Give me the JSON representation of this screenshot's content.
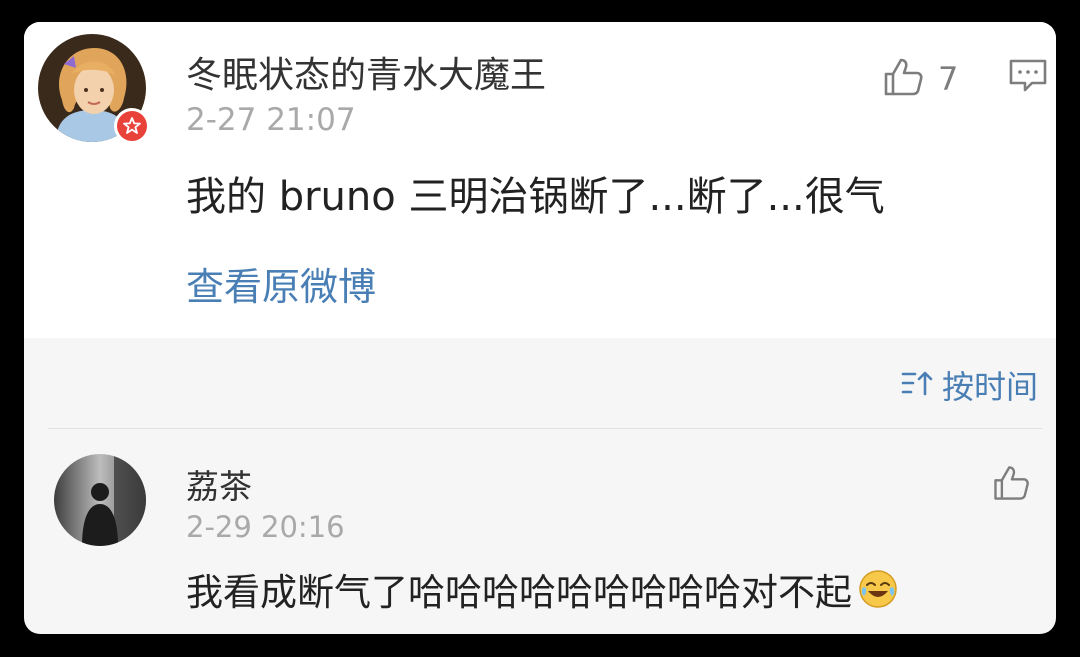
{
  "post": {
    "username": "冬眠状态的青水大魔王",
    "timestamp": "2-27 21:07",
    "text": "我的 bruno 三明治锅断了...断了...很气",
    "view_original": "查看原微博",
    "like_count": "7",
    "like_icon": "thumbs-up-icon",
    "comment_icon": "comment-icon",
    "badge_icon": "verified-star-icon",
    "badge_color": "#e8423a"
  },
  "sort": {
    "label": "按时间",
    "icon": "sort-icon"
  },
  "reply": {
    "username": "荔茶",
    "timestamp": "2-29 20:16",
    "text": "我看成断气了哈哈哈哈哈哈哈哈哈对不起",
    "emoji": "laughing-crying-emoji",
    "like_icon": "thumbs-up-icon"
  },
  "colors": {
    "link": "#4a7fb5",
    "primary_text": "#222222",
    "secondary_text": "#a9a9a9",
    "background": "#f6f6f6"
  }
}
